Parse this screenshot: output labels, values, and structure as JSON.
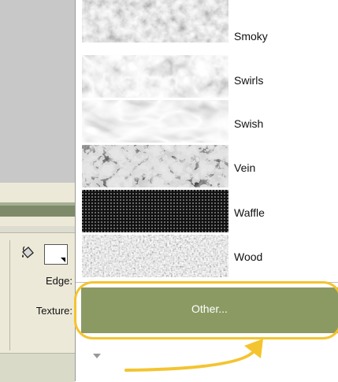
{
  "menu": {
    "items": [
      {
        "label": "Smoky",
        "texture": "smoky"
      },
      {
        "label": "Swirls",
        "texture": "swirls"
      },
      {
        "label": "Swish",
        "texture": "swish"
      },
      {
        "label": "Vein",
        "texture": "vein"
      },
      {
        "label": "Waffle",
        "texture": "waffle"
      },
      {
        "label": "Wood",
        "texture": "wood"
      }
    ],
    "other_label": "Other..."
  },
  "panel": {
    "edge_label": "Edge:",
    "texture_label": "Texture:",
    "fill_color": "#ffffff",
    "icon": "paint-bucket-icon"
  },
  "colors": {
    "highlight": "#8B9A63",
    "annotation": "#F4C430"
  }
}
